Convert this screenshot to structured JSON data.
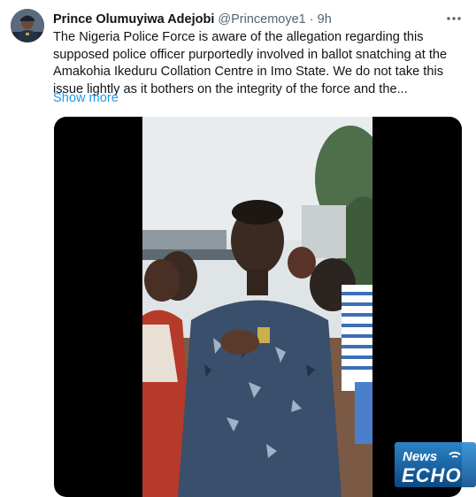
{
  "tweet": {
    "author_name": "Prince Olumuyiwa Adejobi",
    "handle": "@Princemoye1",
    "separator": "·",
    "time": "9h",
    "text": "The Nigeria Police Force is aware of the allegation regarding this supposed police officer purportedly involved in ballot snatching at the Amakohia Ikeduru Collation Centre in Imo State. We do not take this issue lightly as it bothers on the integrity of the force and the...",
    "show_more": "Show more",
    "more_icon": "more-horizontal-icon"
  },
  "watermark": {
    "line1": "News",
    "line2": "ECHO"
  },
  "colors": {
    "link": "#1d9bf0",
    "muted": "#536471",
    "text": "#0f1419",
    "media_bg": "#000000"
  }
}
